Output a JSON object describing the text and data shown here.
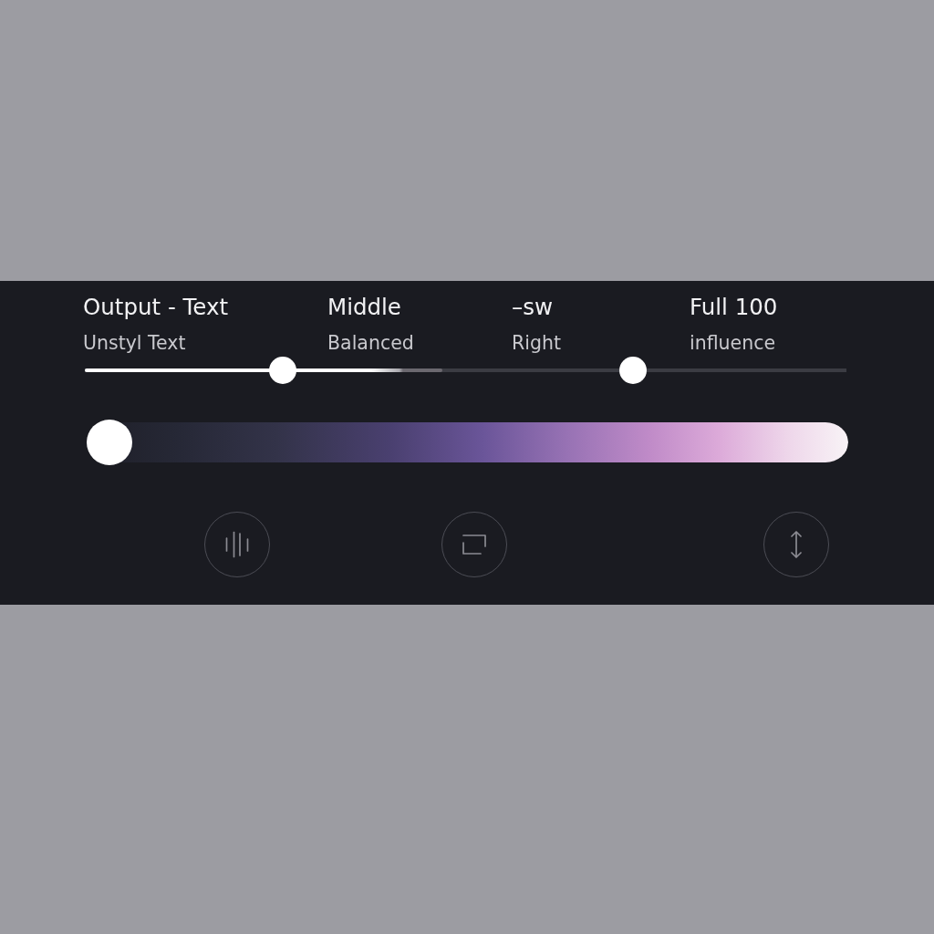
{
  "labels": [
    {
      "title": "Output - Text",
      "subtitle": "Unstyl Text"
    },
    {
      "title": "Middle",
      "subtitle": "Balanced"
    },
    {
      "title": "–sw",
      "subtitle": "Right"
    },
    {
      "title": "Full 100",
      "subtitle": "influence"
    }
  ],
  "range_slider": {
    "fill": {
      "level": 0.47
    },
    "thumbs": [
      {
        "level": 0.26
      },
      {
        "level": 0.72
      }
    ]
  },
  "gradient_slider": {
    "level": 0
  }
}
